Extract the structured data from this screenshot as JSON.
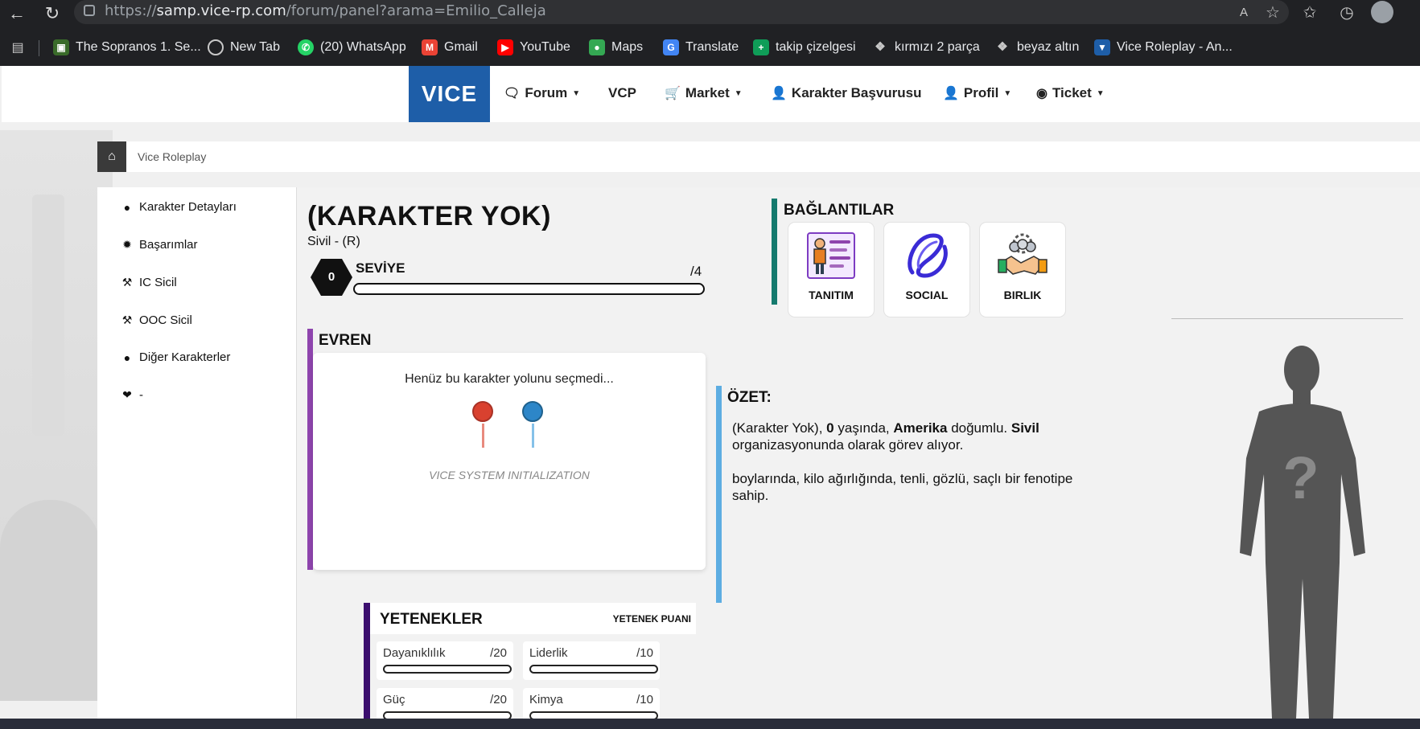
{
  "browser": {
    "url_prefix": "https://",
    "url_host": "samp.vice-rp.com",
    "url_path": "/forum/panel?arama=Emilio_Calleja",
    "read_aloud_label": "A",
    "bookmarks": [
      {
        "label": "The Sopranos 1. Se...",
        "icon": "tv-icon",
        "color": "#3a6b2a"
      },
      {
        "label": "New Tab",
        "icon": "globe-icon",
        "color": "#5f6368"
      },
      {
        "label": "(20) WhatsApp",
        "icon": "whatsapp-icon",
        "color": "#25d366"
      },
      {
        "label": "Gmail",
        "icon": "gmail-icon",
        "color": "#ea4335"
      },
      {
        "label": "YouTube",
        "icon": "youtube-icon",
        "color": "#ff0000"
      },
      {
        "label": "Maps",
        "icon": "maps-icon",
        "color": "#34a853"
      },
      {
        "label": "Translate",
        "icon": "translate-icon",
        "color": "#4285f4"
      },
      {
        "label": "takip çizelgesi",
        "icon": "sheets-icon",
        "color": "#0f9d58"
      },
      {
        "label": "kırmızı 2 parça",
        "icon": "link-icon",
        "color": "#5f6368"
      },
      {
        "label": "beyaz altın",
        "icon": "link-icon",
        "color": "#5f6368"
      },
      {
        "label": "Vice Roleplay - An...",
        "icon": "vice-icon",
        "color": "#1e5ea8"
      }
    ]
  },
  "nav": {
    "logo": "VICE",
    "items": [
      {
        "label": "Forum",
        "icon": "comments-icon",
        "dropdown": true
      },
      {
        "label": "VCP",
        "icon": "",
        "dropdown": false
      },
      {
        "label": "Market",
        "icon": "cart-icon",
        "dropdown": true
      },
      {
        "label": "Karakter Başvurusu",
        "icon": "user-plus-icon",
        "dropdown": false
      },
      {
        "label": "Profil",
        "icon": "user-icon",
        "dropdown": true
      },
      {
        "label": "Ticket",
        "icon": "lifebuoy-icon",
        "dropdown": true
      }
    ]
  },
  "breadcrumb": {
    "home_icon": "home-icon",
    "text": "Vice Roleplay"
  },
  "sidebar": {
    "items": [
      {
        "label": "Karakter Detayları",
        "icon": "user-icon"
      },
      {
        "label": "Başarımlar",
        "icon": "badge-icon"
      },
      {
        "label": "IC Sicil",
        "icon": "gavel-icon"
      },
      {
        "label": "OOC Sicil",
        "icon": "gavel-icon"
      },
      {
        "label": "Diğer Karakterler",
        "icon": "users-icon"
      },
      {
        "label": "-",
        "icon": "heart-icon"
      }
    ]
  },
  "character": {
    "name": "(KARAKTER YOK)",
    "subtitle": "Sivil - (R)",
    "level": "0",
    "level_label": "SEVİYE",
    "level_max": "/4",
    "level_progress": 0
  },
  "connections": {
    "title": "BAĞLANTILAR",
    "items": [
      {
        "label": "TANITIM",
        "icon": "profile-card-icon"
      },
      {
        "label": "SOCIAL",
        "icon": "social-swirl-icon"
      },
      {
        "label": "BIRLIK",
        "icon": "handshake-icon"
      }
    ]
  },
  "evren": {
    "title": "EVREN",
    "message": "Henüz bu karakter yolunu seçmedi...",
    "footer": "VICE SYSTEM INITIALIZATION",
    "pin_colors": [
      "#d9412f",
      "#2d86c8"
    ]
  },
  "ozet": {
    "title": "ÖZET:",
    "line1_pre": "(Karakter Yok), ",
    "line1_age": "0",
    "line1_mid": " yaşında, ",
    "line1_country": "Amerika",
    "line1_mid2": " doğumlu. ",
    "line1_org": "Sivil",
    "line1_post": " organizasyonunda olarak görev alıyor.",
    "line2": "boylarında, kilo ağırlığında, tenli, gözlü, saçlı bir fenotipe sahip."
  },
  "silhouette": {
    "mark": "?"
  },
  "skills": {
    "title": "YETENEKLER",
    "points_label": "YETENEK PUANI",
    "items": [
      {
        "name": "Dayanıklılık",
        "max": "/20"
      },
      {
        "name": "Liderlik",
        "max": "/10"
      },
      {
        "name": "Güç",
        "max": "/20"
      },
      {
        "name": "Kimya",
        "max": "/10"
      }
    ]
  }
}
